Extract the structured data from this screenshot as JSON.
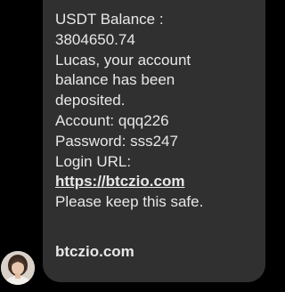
{
  "message": {
    "lines": [
      "USDT Balance :",
      "3804650.74",
      "Lucas, your account",
      "balance has been",
      "deposited.",
      "Account: qqq226",
      "Password: sss247",
      "Login URL:"
    ],
    "link": "https://btczio.com",
    "closing": "Please keep this safe."
  },
  "link_preview": {
    "domain": "btczio.com"
  },
  "colors": {
    "background": "#000000",
    "bubble": "#303030",
    "text": "#e8e8e8"
  },
  "icons": {
    "avatar": "sender-avatar-photo"
  }
}
